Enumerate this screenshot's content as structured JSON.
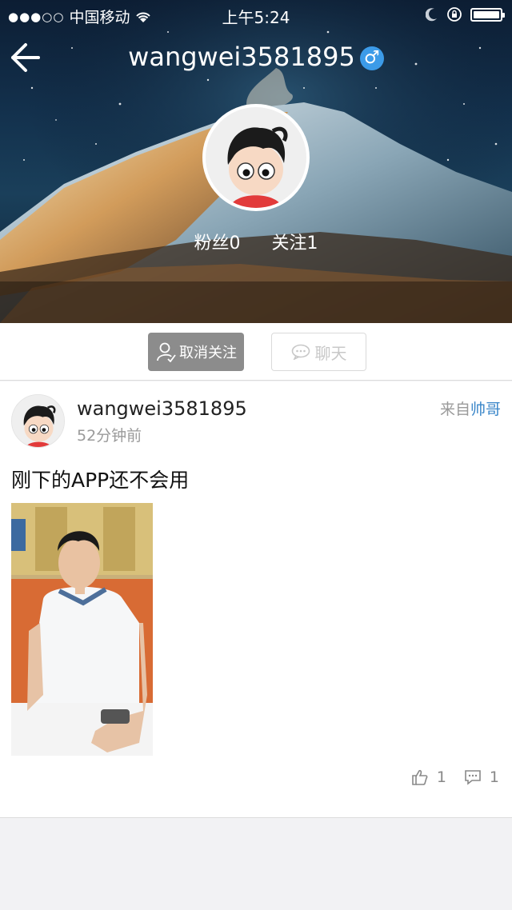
{
  "status_bar": {
    "signal": "●●●○○",
    "carrier": "中国移动",
    "time": "上午5:24"
  },
  "header": {
    "username": "wangwei3581895",
    "gender_symbol": "♂",
    "fans_label": "粉丝0",
    "following_label": "关注1"
  },
  "actions": {
    "unfollow_label": "取消关注",
    "chat_label": "聊天"
  },
  "post": {
    "username": "wangwei3581895",
    "time": "52分钟前",
    "source_prefix": "来自",
    "source_name": "帅哥",
    "text": "刚下的APP还不会用",
    "like_count": "1",
    "comment_count": "1"
  },
  "colors": {
    "accent_blue": "#3a86c9",
    "gender_badge": "#3c9be8",
    "unfollow_bg": "#8c8c8c"
  },
  "icons": [
    "back-arrow-icon",
    "male-gender-icon",
    "wifi-icon",
    "moon-icon",
    "rotation-lock-icon",
    "battery-icon",
    "unfollow-user-icon",
    "chat-bubble-icon",
    "thumbs-up-icon",
    "comment-icon"
  ]
}
